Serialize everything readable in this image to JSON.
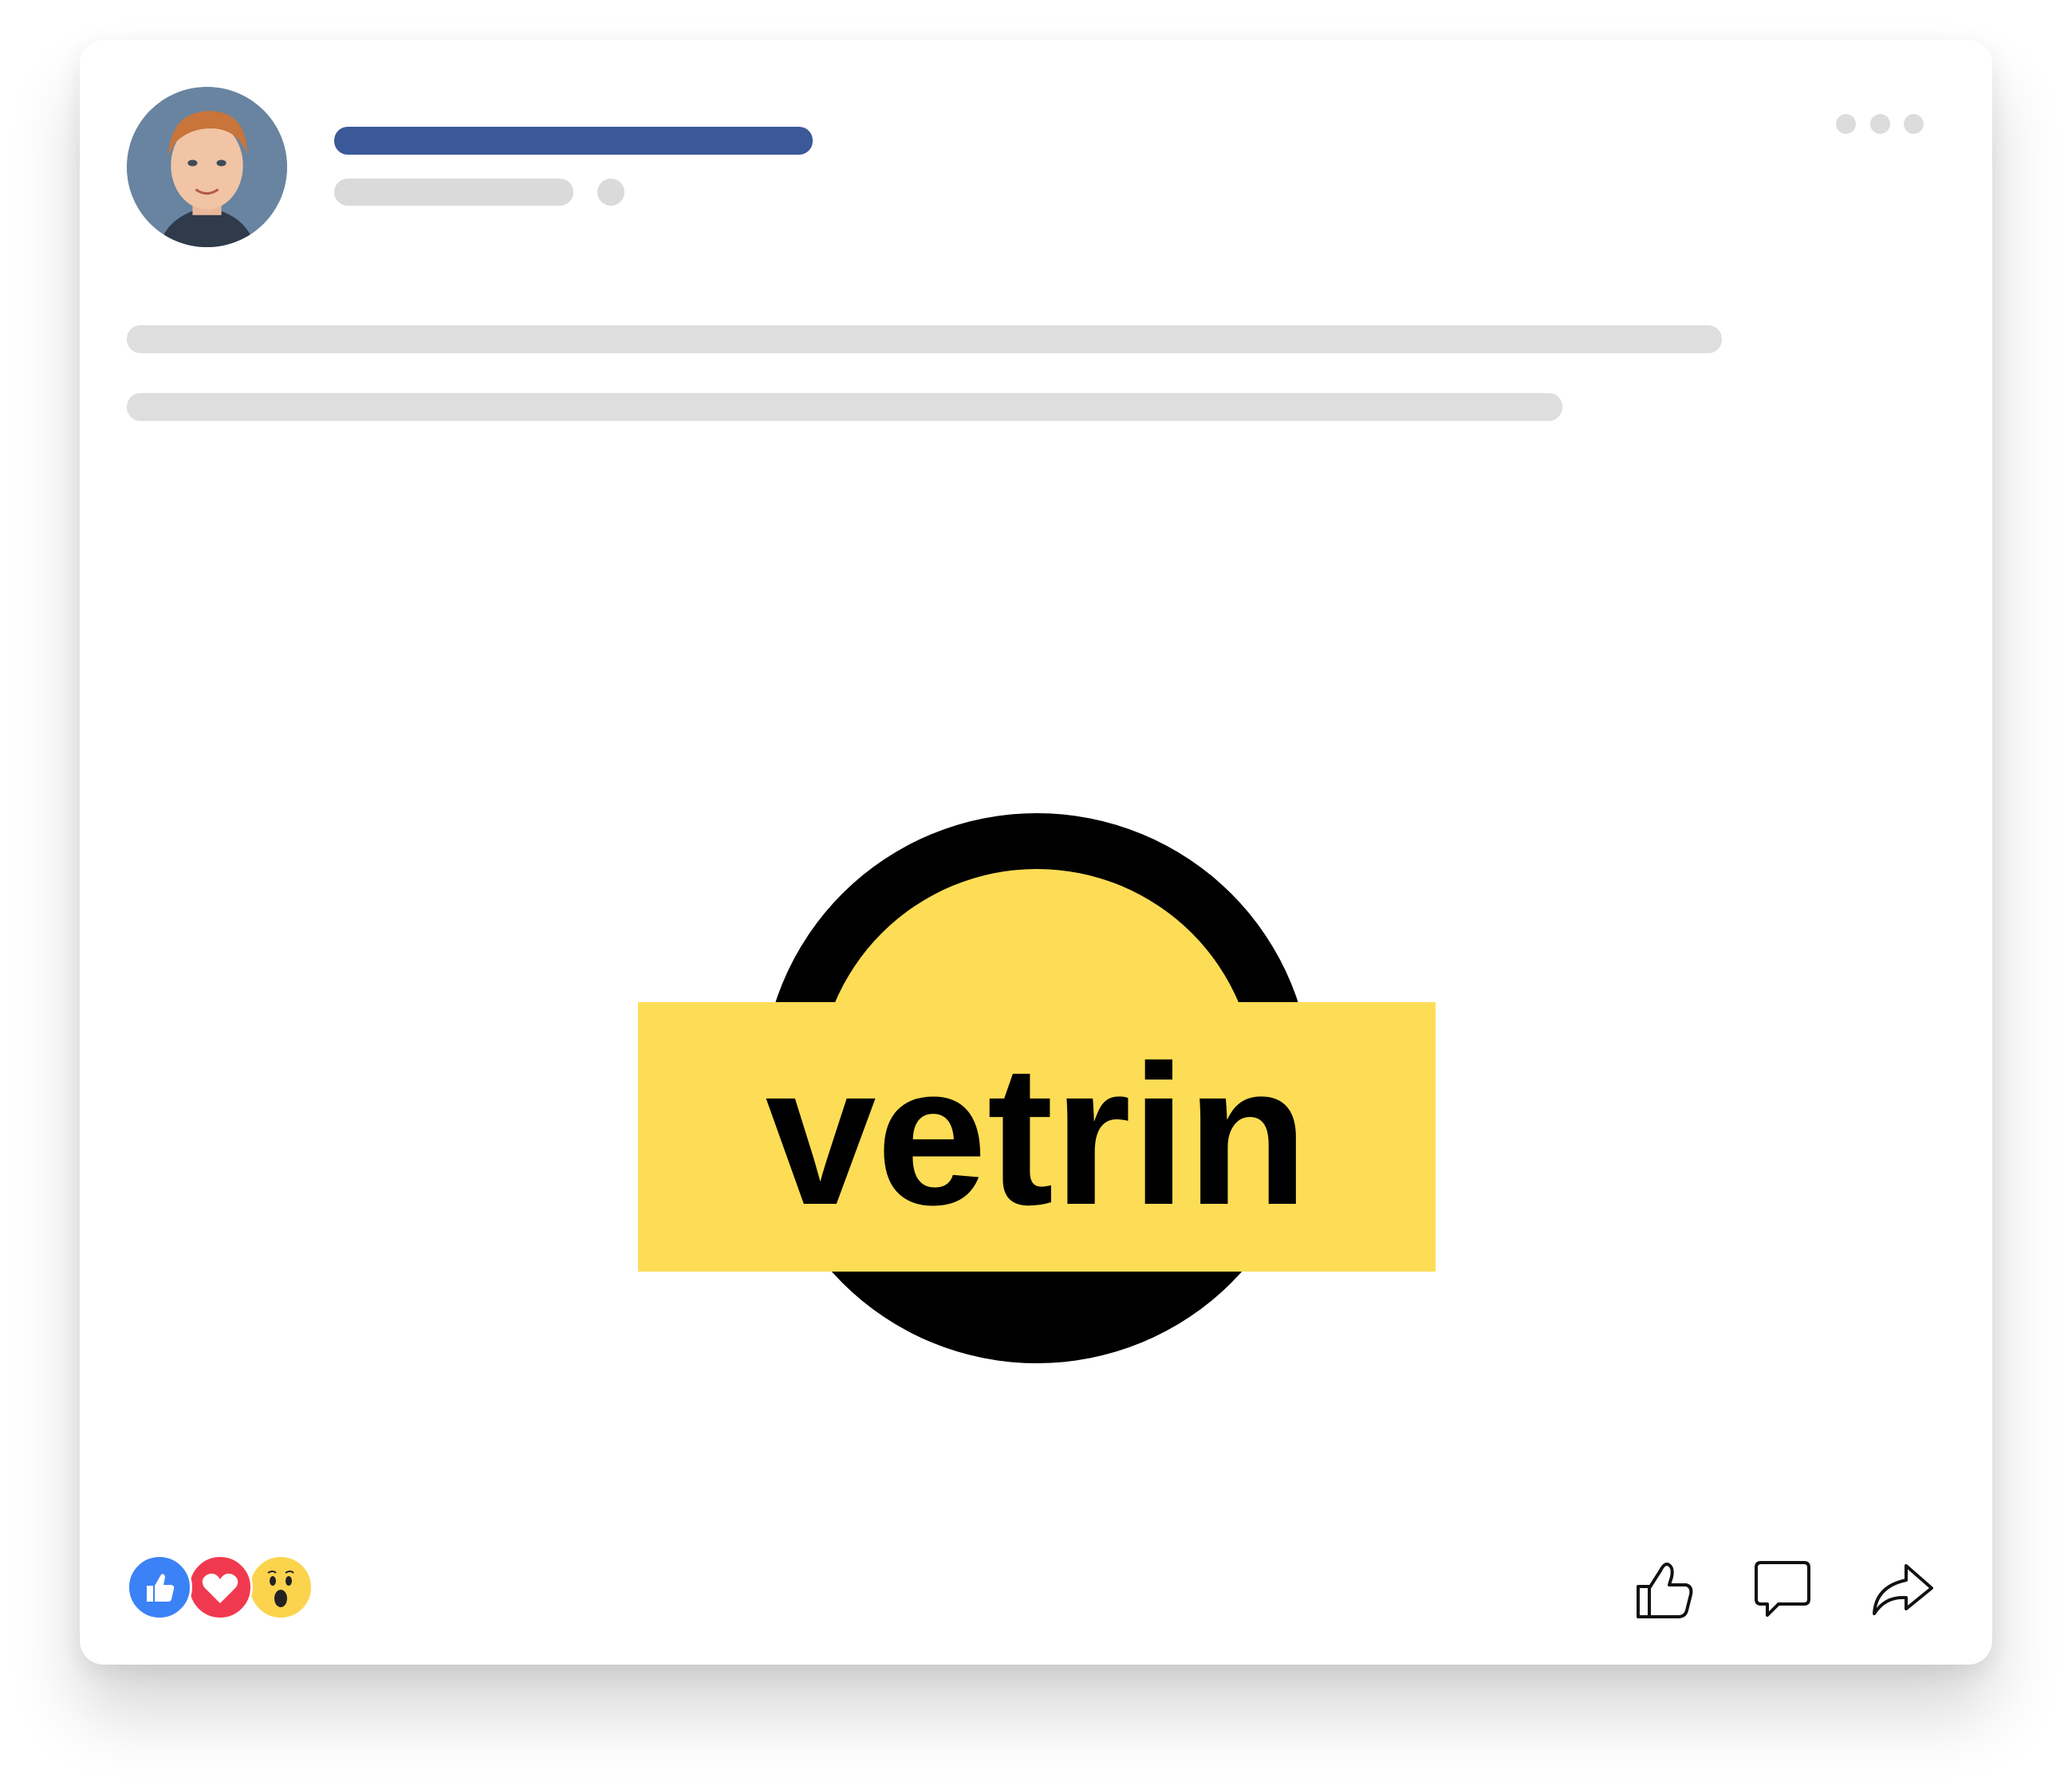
{
  "post": {
    "logo_text": "vetrin",
    "logo_colors": {
      "yellow": "#fddd55",
      "black": "#000000"
    }
  },
  "placeholders": {
    "name_bar_color": "#3b5998",
    "skeleton_color": "#dadada"
  },
  "reactions": [
    {
      "name": "like",
      "icon": "thumbs-up-icon",
      "color": "#3b82f6"
    },
    {
      "name": "love",
      "icon": "heart-icon",
      "color": "#f0394e"
    },
    {
      "name": "wow",
      "icon": "surprised-face-icon",
      "color": "#fcd34d"
    }
  ],
  "actions": [
    {
      "name": "like",
      "icon": "thumbs-up-outline-icon"
    },
    {
      "name": "comment",
      "icon": "speech-bubble-icon"
    },
    {
      "name": "share",
      "icon": "share-arrow-icon"
    }
  ]
}
